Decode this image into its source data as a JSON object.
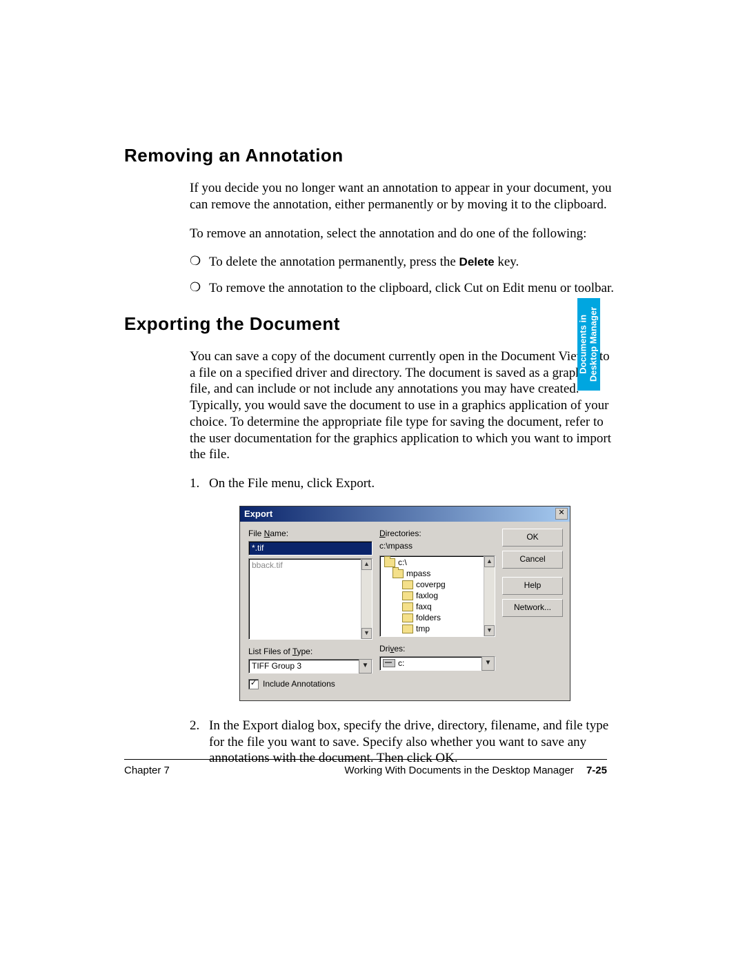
{
  "headings": {
    "h1": "Removing an Annotation",
    "h2": "Exporting the Document"
  },
  "removing": {
    "p1": "If you decide you no longer want an annotation to appear in your document, you can remove the annotation, either permanently or by moving it to the clipboard.",
    "p2": "To remove an annotation, select the annotation and do one of the following:",
    "b1_pre": "To delete the annotation permanently, press the ",
    "b1_key": "Delete",
    "b1_post": " key.",
    "b2": "To remove the annotation to the clipboard, click Cut on Edit menu or toolbar."
  },
  "exporting": {
    "p1": "You can save a copy of the document currently open in the Document Viewer to a file on a specified driver and directory. The document is saved as a graphic file, and can include or not include any annotations you may have created. Typically, you would save the document to use in a graphics application of your choice. To determine the appropriate file type for saving the document, refer to the user documentation for the graphics application to which you want to import the file.",
    "step1_num": "1.",
    "step1_txt": "On the File menu, click Export.",
    "step2_num": "2.",
    "step2_txt": "In the Export dialog box, specify the drive, directory, filename, and file type for the file you want to save. Specify also whether you want to save any annotations with the document. Then click OK."
  },
  "dialog": {
    "title": "Export",
    "close": "✕",
    "filename_label_pre": "File ",
    "filename_label_ul": "N",
    "filename_label_post": "ame:",
    "filename_value": "*.tif",
    "filelist_item": "bback.tif",
    "dirs_label_ul": "D",
    "dirs_label_post": "irectories:",
    "dirs_path": "c:\\mpass",
    "dirs": {
      "d0": "c:\\",
      "d1": "mpass",
      "d2": "coverpg",
      "d3": "faxlog",
      "d4": "faxq",
      "d5": "folders",
      "d6": "tmp"
    },
    "listtype_label_pre": "List Files of ",
    "listtype_label_ul": "T",
    "listtype_label_post": "ype:",
    "listtype_value": "TIFF Group 3",
    "drives_label_pre": "Dri",
    "drives_label_ul": "v",
    "drives_label_post": "es:",
    "drives_value": "c:",
    "buttons": {
      "ok": "OK",
      "cancel": "Cancel",
      "help_ul": "H",
      "help_post": "elp",
      "network_pre": "Net",
      "network_ul": "w",
      "network_post": "ork..."
    },
    "checkbox_mark": "✓",
    "checkbox_label_ul": "I",
    "checkbox_label_post": "nclude Annotations"
  },
  "sidetab": {
    "l1": "Documents in",
    "l2": "Desktop Manager"
  },
  "footer": {
    "left": "Chapter 7",
    "right": "Working With Documents in the Desktop Manager",
    "page": "7-25"
  }
}
